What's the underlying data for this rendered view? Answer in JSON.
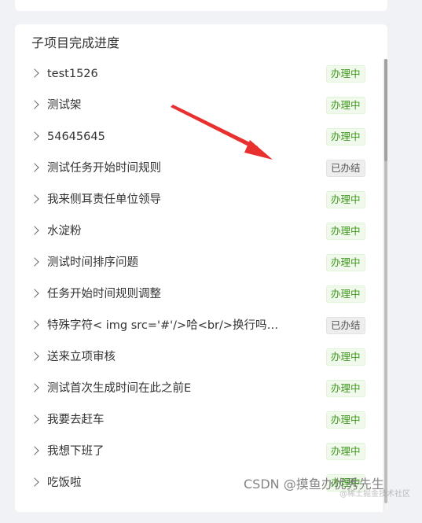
{
  "panel": {
    "title": "子项目完成进度"
  },
  "status_labels": {
    "processing": "办理中",
    "done": "已办结"
  },
  "items": [
    {
      "label": "test1526",
      "status": "办理中",
      "state": "processing"
    },
    {
      "label": "测试架",
      "status": "办理中",
      "state": "processing"
    },
    {
      "label": "54645645",
      "status": "办理中",
      "state": "processing"
    },
    {
      "label": "测试任务开始时间规则",
      "status": "已办结",
      "state": "done"
    },
    {
      "label": "我来侧耳责任单位领导",
      "status": "办理中",
      "state": "processing"
    },
    {
      "label": "水淀粉",
      "status": "办理中",
      "state": "processing"
    },
    {
      "label": "测试时间排序问题",
      "status": "办理中",
      "state": "processing"
    },
    {
      "label": "任务开始时间规则调整",
      "status": "办理中",
      "state": "processing"
    },
    {
      "label": "特殊字符< img src='#'/>哈<br/>换行吗？ 所...",
      "status": "已办结",
      "state": "done"
    },
    {
      "label": "送来立项审核",
      "status": "办理中",
      "state": "processing"
    },
    {
      "label": "测试首次生成时间在此之前E",
      "status": "办理中",
      "state": "processing"
    },
    {
      "label": "我要去赶车",
      "status": "办理中",
      "state": "processing"
    },
    {
      "label": "我想下班了",
      "status": "办理中",
      "state": "processing"
    },
    {
      "label": "吃饭啦",
      "status": "办理中",
      "state": "processing"
    }
  ],
  "colors": {
    "accent_red": "#e8302f",
    "processing_text": "#3e9a1c",
    "processing_bg": "#f0f9eb",
    "done_text": "#555555",
    "done_bg": "#eeeeee"
  },
  "watermark": {
    "main": "CSDN @摸鱼办优秀先生",
    "sub": "@稀土掘金技术社区"
  }
}
